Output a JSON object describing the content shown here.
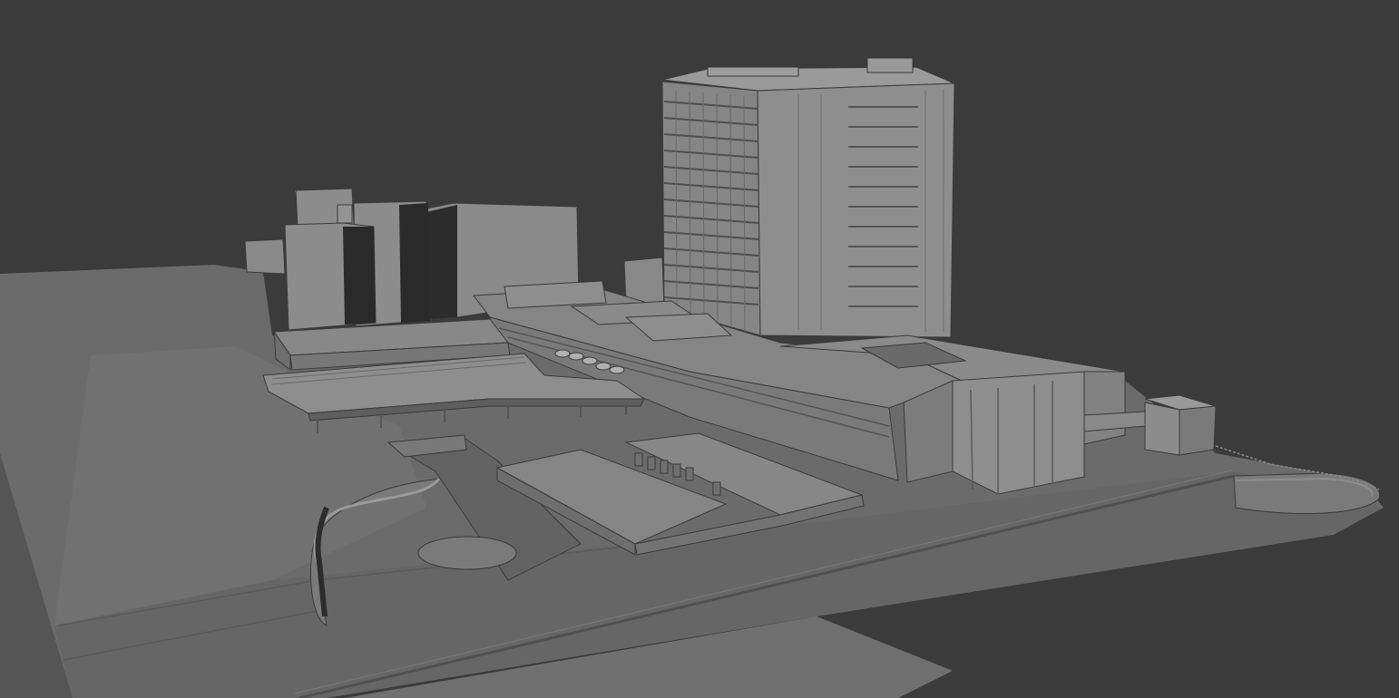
{
  "viewport": {
    "background": "#3b3b3b",
    "mode": "solid-shading"
  },
  "palette": {
    "ground_top": "#6b6b6b",
    "ground_light": "#757575",
    "ground_mid": "#666666",
    "ground_edge": "#595959",
    "ground_side": "#4a4a4a",
    "roof": "#8a8a8a",
    "facade_lit": "#8e8e8e",
    "facade_mid": "#7d7d7d",
    "facade_shadow": "#2b2b2b",
    "window_line": "#505050",
    "outline": "#3a3a3a"
  },
  "scene": {
    "objects": [
      "terrain-plane",
      "high-rise-tower",
      "background-residential-blocks",
      "podium-building",
      "canopy-pavilion",
      "sunken-courtyard",
      "low-annex-building",
      "curved-retaining-wall",
      "circular-plaza",
      "east-block",
      "small-east-pavilion",
      "curved-ramp",
      "perimeter-railing"
    ]
  }
}
